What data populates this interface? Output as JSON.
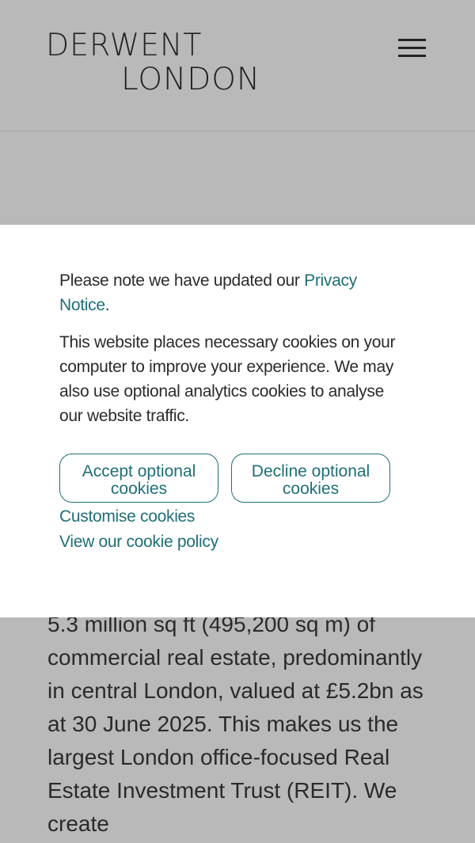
{
  "header": {
    "logo_line1": "DERWENT",
    "logo_line2": "LONDON",
    "menu_icon": "hamburger-menu-icon"
  },
  "cookie_banner": {
    "notice_prefix": "Please note we have updated our ",
    "notice_link": "Privacy Notice",
    "notice_suffix": ".",
    "description": "This website places necessary cookies on your computer to improve your experience. We may also use optional analytics cookies to analyse our website traffic.",
    "accept_button": "Accept optional cookies",
    "decline_button": "Decline optional cookies",
    "customise_link": "Customise cookies",
    "policy_link": "View our cookie policy"
  },
  "main": {
    "body_text": "5.3 million sq ft (495,200 sq m) of commercial real estate, predominantly in central London, valued at £5.2bn as at 30 June 2025. This makes us the largest London office-focused Real Estate Investment Trust (REIT). We create"
  },
  "colors": {
    "overlay_gray": "#b9b9b9",
    "accent_teal": "#1d6f78",
    "text_dark": "#2b2b2b"
  }
}
